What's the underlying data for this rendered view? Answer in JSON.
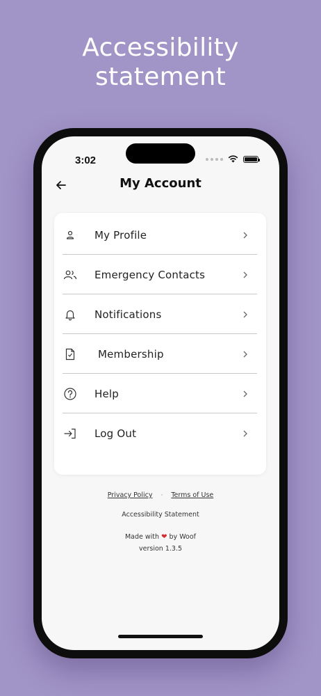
{
  "headline": "Accessibility statement",
  "status": {
    "time": "3:02"
  },
  "header": {
    "title": "My Account"
  },
  "menu": [
    {
      "label": "My Profile",
      "icon": "person-icon"
    },
    {
      "label": "Emergency Contacts",
      "icon": "people-icon"
    },
    {
      "label": "Notifications",
      "icon": "bell-icon"
    },
    {
      "label": " Membership",
      "icon": "document-check-icon"
    },
    {
      "label": "Help",
      "icon": "question-circle-icon"
    },
    {
      "label": "Log Out",
      "icon": "logout-icon"
    }
  ],
  "footer": {
    "privacy": "Privacy Policy",
    "separator": "·",
    "terms": "Terms of Use",
    "accessibility": "Accessibility Statement",
    "made_prefix": "Made with",
    "heart": "❤",
    "made_suffix": "by Woof",
    "version": "version 1.3.5"
  },
  "colors": {
    "background": "#a194c6",
    "screen": "#f7f7f7",
    "card": "#ffffff",
    "heart": "#d62b2b"
  }
}
